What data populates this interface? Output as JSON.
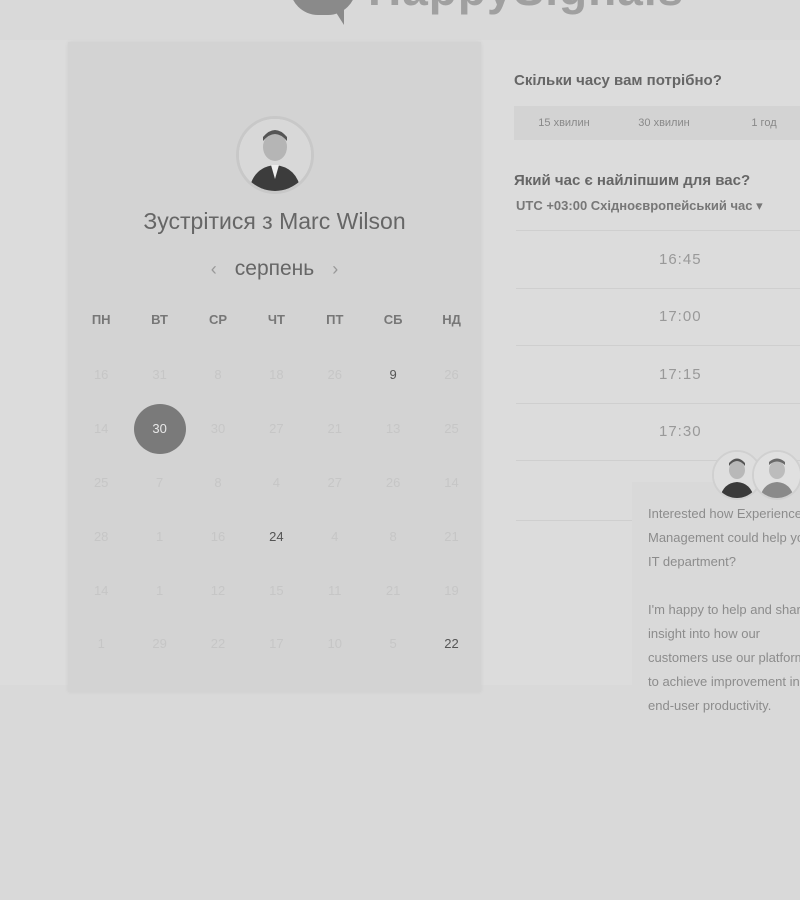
{
  "logo": {
    "text": "HappySignals"
  },
  "calendar": {
    "title": "Зустрітися з Marc Wilson",
    "month": "серпень",
    "prev": "‹",
    "next": "›",
    "weekdays": [
      "ПН",
      "ВТ",
      "СР",
      "ЧТ",
      "ПТ",
      "СБ",
      "НД"
    ],
    "weeks": [
      [
        "16",
        "31",
        "8",
        "18",
        "26",
        "9",
        "26"
      ],
      [
        "14",
        "30",
        "30",
        "27",
        "21",
        "13",
        "25"
      ],
      [
        "25",
        "7",
        "8",
        "4",
        "27",
        "26",
        "14"
      ],
      [
        "28",
        "1",
        "16",
        "24",
        "4",
        "8",
        "21"
      ],
      [
        "14",
        "1",
        "12",
        "15",
        "11",
        "21",
        "19"
      ],
      [
        "1",
        "29",
        "22",
        "17",
        "10",
        "5",
        "22"
      ]
    ],
    "available_days": [
      "9",
      "4",
      "22"
    ],
    "selected_day": "30"
  },
  "duration": {
    "question": "Скільки часу вам потрібно?",
    "options": [
      "15 хвилин",
      "30 хвилин",
      "1 год"
    ]
  },
  "time": {
    "question": "Який час є найліпшим для вас?",
    "timezone": "UTC +03:00 Східноєвропейський час",
    "timezone_caret": "▾",
    "slots": [
      "16:45",
      "17:00",
      "17:15",
      "17:30"
    ]
  },
  "chat": {
    "paragraph1": "Interested how Experience Management could help your IT department?",
    "paragraph2": "I'm happy to help and share insight into how our customers use our platform to achieve improvement in IT end-user productivity."
  },
  "colors": {
    "background": "#d9d9d9",
    "selected_day": "#7a7a7a"
  }
}
